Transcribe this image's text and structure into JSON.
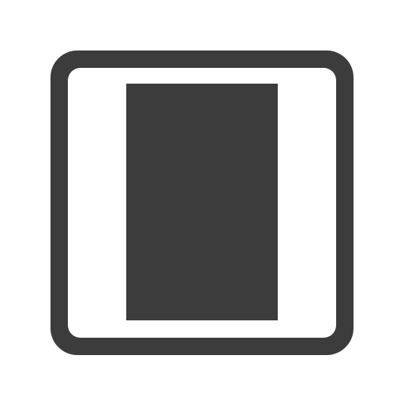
{
  "icon": {
    "name": "single-page-layout-icon",
    "colors": {
      "foreground": "#3c3c3c",
      "background": "#ffffff"
    }
  }
}
